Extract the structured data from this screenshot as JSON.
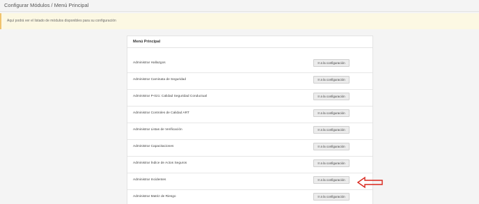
{
  "header": {
    "title": "Configurar Módulos / Menú Principal"
  },
  "alert": {
    "text": "Aquí podrá ver el listado de módulos disponibles para su configuración"
  },
  "panel": {
    "title": "Menú Principal",
    "button_label": "Ir a la configuración",
    "rows": [
      {
        "label": "Administrar Hallazgos"
      },
      {
        "label": "Administrar Caminata de Seguridad"
      },
      {
        "label": "Administrar P-021: Calidad Seguridad Conductual"
      },
      {
        "label": "Administrar Controles de Calidad ART"
      },
      {
        "label": "Administrar Listas de Verificación"
      },
      {
        "label": "Administrar Capacitaciones"
      },
      {
        "label": "Administrar Índice de Actos Seguros"
      },
      {
        "label": "Administrar Incidentes"
      },
      {
        "label": "Administrar Matriz de Riesgo"
      }
    ]
  },
  "annotation": {
    "arrow_color": "#d9261c"
  }
}
